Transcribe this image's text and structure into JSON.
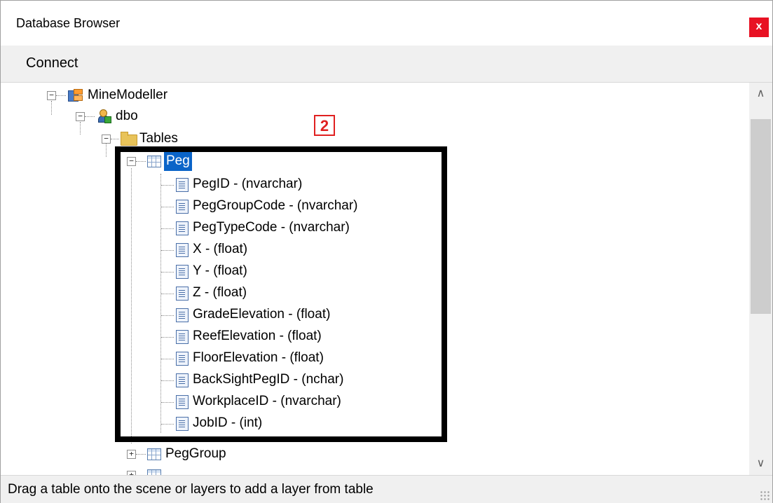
{
  "window": {
    "title": "Database Browser",
    "close_label": "x"
  },
  "menu": {
    "connect_label": "Connect"
  },
  "tree": {
    "database": "MineModeller",
    "schema": "dbo",
    "folder": "Tables",
    "selected_table": "Peg",
    "columns": [
      "PegID - (nvarchar)",
      "PegGroupCode - (nvarchar)",
      "PegTypeCode - (nvarchar)",
      "X - (float)",
      "Y - (float)",
      "Z - (float)",
      "GradeElevation - (float)",
      "ReefElevation - (float)",
      "FloorElevation - (float)",
      "BackSightPegID - (nchar)",
      "WorkplaceID - (nvarchar)",
      "JobID - (int)"
    ],
    "next_table": "PegGroup"
  },
  "annotation": {
    "callout_number": "2",
    "callout_color": "#e02020"
  },
  "status": {
    "text": "Drag a table onto the scene or layers to add a layer from table"
  },
  "colors": {
    "selection": "#0a64c8",
    "close_button": "#e81123"
  }
}
